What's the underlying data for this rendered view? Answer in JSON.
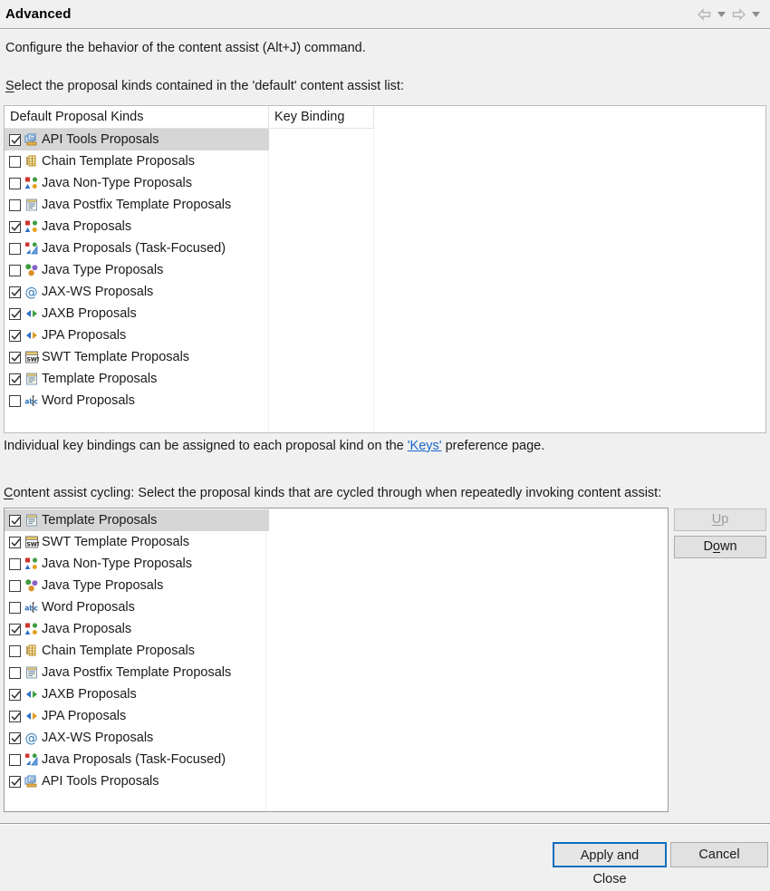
{
  "window": {
    "title": "Advanced",
    "nav": {
      "back_icon": "arrow-left-icon",
      "back_dropdown_icon": "chevron-down-icon",
      "forward_icon": "arrow-right-icon",
      "forward_dropdown_icon": "chevron-down-icon"
    }
  },
  "description": "Configure the behavior of the content assist (Alt+J) command.",
  "default_list": {
    "label_mnemonic": "S",
    "label_rest": "elect the proposal kinds contained in the 'default' content assist list:",
    "columns": [
      "Default Proposal Kinds",
      "Key Binding"
    ],
    "rows": [
      {
        "label": "API Tools Proposals",
        "checked": true,
        "selected": true,
        "icon": "api-tools-icon"
      },
      {
        "label": "Chain Template Proposals",
        "checked": false,
        "selected": false,
        "icon": "chain-template-icon"
      },
      {
        "label": "Java Non-Type Proposals",
        "checked": false,
        "selected": false,
        "icon": "java-nontype-icon"
      },
      {
        "label": "Java Postfix Template Proposals",
        "checked": false,
        "selected": false,
        "icon": "template-icon"
      },
      {
        "label": "Java Proposals",
        "checked": true,
        "selected": false,
        "icon": "java-nontype-icon"
      },
      {
        "label": "Java Proposals (Task-Focused)",
        "checked": false,
        "selected": false,
        "icon": "java-task-icon"
      },
      {
        "label": "Java Type Proposals",
        "checked": false,
        "selected": false,
        "icon": "java-type-icon"
      },
      {
        "label": "JAX-WS Proposals",
        "checked": true,
        "selected": false,
        "icon": "at-sign-icon"
      },
      {
        "label": "JAXB Proposals",
        "checked": true,
        "selected": false,
        "icon": "jaxb-arrows-icon"
      },
      {
        "label": "JPA Proposals",
        "checked": true,
        "selected": false,
        "icon": "jpa-arrows-icon"
      },
      {
        "label": "SWT Template Proposals",
        "checked": true,
        "selected": false,
        "icon": "swt-template-icon"
      },
      {
        "label": "Template Proposals",
        "checked": true,
        "selected": false,
        "icon": "template-icon"
      },
      {
        "label": "Word Proposals",
        "checked": false,
        "selected": false,
        "icon": "word-abc-icon"
      }
    ]
  },
  "keys_hint": {
    "prefix": "Individual key bindings can be assigned to each proposal kind on the ",
    "link": "'Keys'",
    "suffix": " preference page."
  },
  "cycling_list": {
    "label_mnemonic": "C",
    "label_rest": "ontent assist cycling: Select the proposal kinds that are cycled through when repeatedly invoking content assist:",
    "rows": [
      {
        "label": "Template Proposals",
        "checked": true,
        "selected": true,
        "icon": "template-icon"
      },
      {
        "label": "SWT Template Proposals",
        "checked": true,
        "selected": false,
        "icon": "swt-template-icon"
      },
      {
        "label": "Java Non-Type Proposals",
        "checked": false,
        "selected": false,
        "icon": "java-nontype-icon"
      },
      {
        "label": "Java Type Proposals",
        "checked": false,
        "selected": false,
        "icon": "java-type-icon"
      },
      {
        "label": "Word Proposals",
        "checked": false,
        "selected": false,
        "icon": "word-abc-icon"
      },
      {
        "label": "Java Proposals",
        "checked": true,
        "selected": false,
        "icon": "java-nontype-icon"
      },
      {
        "label": "Chain Template Proposals",
        "checked": false,
        "selected": false,
        "icon": "chain-template-icon"
      },
      {
        "label": "Java Postfix Template Proposals",
        "checked": false,
        "selected": false,
        "icon": "template-icon"
      },
      {
        "label": "JAXB Proposals",
        "checked": true,
        "selected": false,
        "icon": "jaxb-arrows-icon"
      },
      {
        "label": "JPA Proposals",
        "checked": true,
        "selected": false,
        "icon": "jpa-arrows-icon"
      },
      {
        "label": "JAX-WS Proposals",
        "checked": true,
        "selected": false,
        "icon": "at-sign-icon"
      },
      {
        "label": "Java Proposals (Task-Focused)",
        "checked": false,
        "selected": false,
        "icon": "java-task-icon"
      },
      {
        "label": "API Tools Proposals",
        "checked": true,
        "selected": false,
        "icon": "api-tools-icon"
      }
    ],
    "up_button": {
      "mnemonic": "U",
      "rest": "p",
      "enabled": false
    },
    "down_button": {
      "pre": "D",
      "mnemonic": "o",
      "rest": "wn",
      "enabled": true
    }
  },
  "footer": {
    "apply_and_close": "Apply and Close",
    "cancel": "Cancel"
  },
  "colors": {
    "link": "#1768c9",
    "focus_border": "#0d6ebf",
    "selection": "#d6d6d6",
    "window_bg": "#f0f0f0"
  }
}
